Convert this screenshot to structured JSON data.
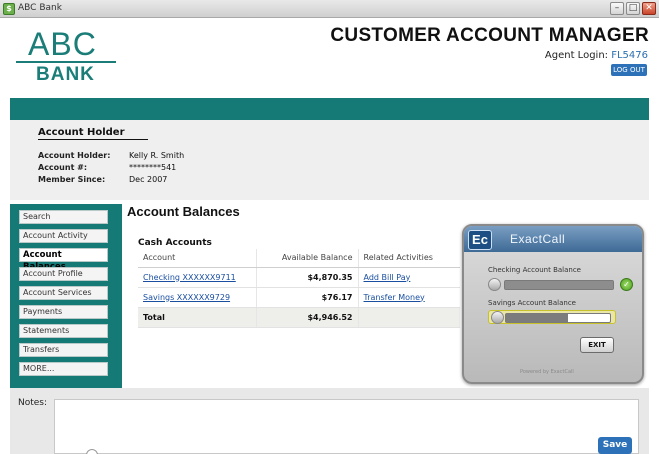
{
  "window": {
    "title": "ABC Bank",
    "app_icon": "bank-app-icon"
  },
  "logo": {
    "line1": "ABC",
    "line2": "BANK",
    "color": "#1a7d78"
  },
  "header": {
    "title": "CUSTOMER ACCOUNT MANAGER",
    "agent_label": "Agent Login:",
    "agent_id": "FL5476",
    "logout_label": "LOG OUT"
  },
  "account_holder": {
    "heading": "Account Holder",
    "fields": [
      {
        "label": "Account Holder:",
        "value": "Kelly R. Smith"
      },
      {
        "label": "Account #:",
        "value": "********541"
      },
      {
        "label": "Member Since:",
        "value": "Dec 2007"
      }
    ]
  },
  "sidebar": {
    "items": [
      {
        "label": "Search"
      },
      {
        "label": "Account Activity"
      },
      {
        "label": "Account Balances"
      },
      {
        "label": "Account Profile"
      },
      {
        "label": "Account Services"
      },
      {
        "label": "Payments"
      },
      {
        "label": "Statements"
      },
      {
        "label": "Transfers"
      },
      {
        "label": "MORE..."
      }
    ],
    "active": "Account Balances"
  },
  "main": {
    "heading": "Account Balances",
    "section": "Cash Accounts",
    "columns": [
      "Account",
      "Available Balance",
      "Related Activities"
    ],
    "rows": [
      {
        "account": "Checking XXXXXX9711",
        "balance": "$4,870.35",
        "activity": "Add Bill Pay"
      },
      {
        "account": "Savings XXXXXX9729",
        "balance": "$76.17",
        "activity": "Transfer Money"
      }
    ],
    "total": {
      "label": "Total",
      "balance": "$4,946.52"
    }
  },
  "exactcall": {
    "logo": "Ec",
    "title": "ExactCall",
    "item1_label": "Checking Account Balance",
    "item1_progress": 1.0,
    "item2_label": "Savings Account Balance",
    "item2_progress": 0.4,
    "exit_label": "EXIT",
    "powered_by": "Powered by ExactCall"
  },
  "notes": {
    "label": "Notes:",
    "save_label": "Save"
  }
}
